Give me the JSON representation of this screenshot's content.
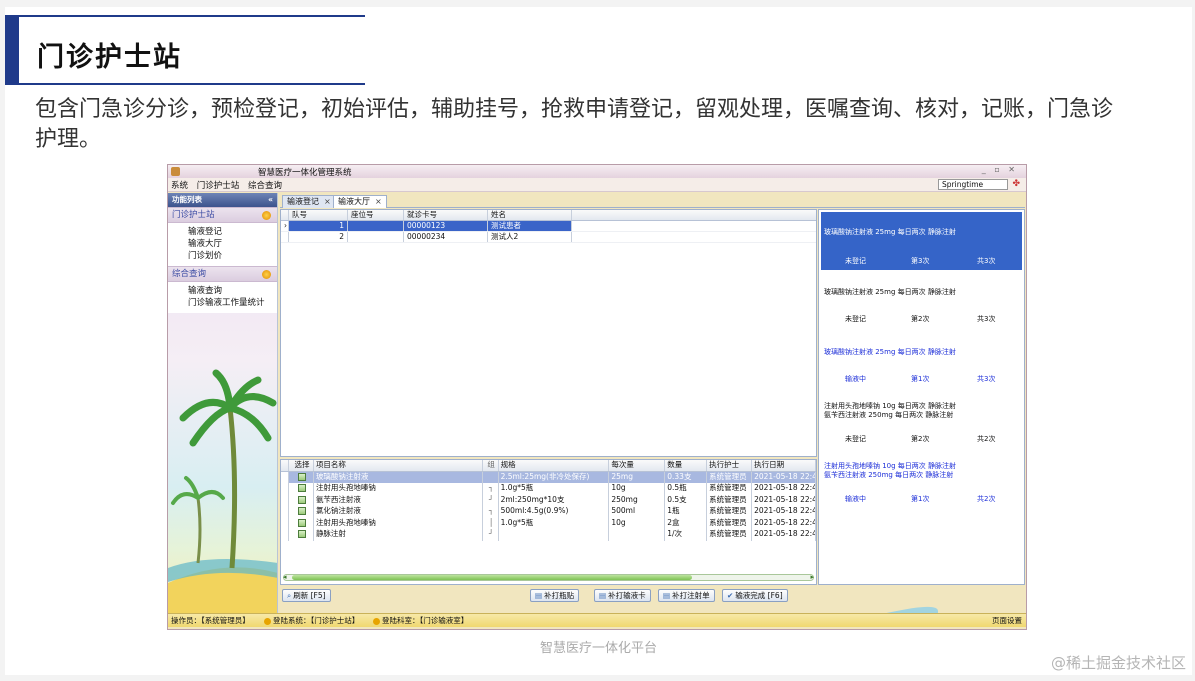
{
  "slide": {
    "title": "门诊护士站",
    "description": "包含门急诊分诊，预检登记，初始评估，辅助挂号，抢救申请登记，留观处理，医嘱查询、核对，记账，门急诊护理。",
    "footer": "智慧医疗一体化平台",
    "watermark": "@稀土掘金技术社区"
  },
  "window": {
    "title": "智慧医疗一体化管理系统",
    "controls": "_ ▫ ✕",
    "menu": [
      "系统",
      "门诊护士站",
      "综合查询"
    ],
    "user_select": "Springtime"
  },
  "nav": {
    "header": "功能列表",
    "pin": "«",
    "groups": [
      {
        "label": "门诊护士站",
        "items": [
          "输液登记",
          "输液大厅",
          "门诊划价"
        ]
      },
      {
        "label": "综合查询",
        "items": [
          "输液查询",
          "门诊输液工作量统计"
        ]
      }
    ]
  },
  "tabs": [
    {
      "label": "输液登记",
      "close": "×"
    },
    {
      "label": "输液大厅",
      "close": "×"
    }
  ],
  "queue_table": {
    "columns": [
      "队号",
      "座位号",
      "就诊卡号",
      "姓名"
    ],
    "rows": [
      {
        "queue": "1",
        "seat": "",
        "card": "00000123",
        "name": "测试患者"
      },
      {
        "queue": "2",
        "seat": "",
        "card": "00000234",
        "name": "测试人2"
      }
    ]
  },
  "items_table": {
    "columns": [
      "选择",
      "项目名称",
      "组",
      "规格",
      "每次量",
      "数量",
      "执行护士",
      "执行日期"
    ],
    "rows": [
      {
        "name": "玻璃酸钠注射液",
        "group": "",
        "spec": "2.5ml:25mg(非冷处保存)",
        "dose": "25mg",
        "qty": "0.33支",
        "nurse": "系统管理员",
        "date": "2021-05-18 22:43:"
      },
      {
        "name": "注射用头孢地嗪钠",
        "group": "┐",
        "spec": "1.0g*5瓶",
        "dose": "10g",
        "qty": "0.5瓶",
        "nurse": "系统管理员",
        "date": "2021-05-18 22:43:"
      },
      {
        "name": "氨苄西注射液",
        "group": "┘",
        "spec": "2ml:250mg*10支",
        "dose": "250mg",
        "qty": "0.5支",
        "nurse": "系统管理员",
        "date": "2021-05-18 22:43:"
      },
      {
        "name": "氯化钠注射液",
        "group": "┐",
        "spec": "500ml:4.5g(0.9%)",
        "dose": "500ml",
        "qty": "1瓶",
        "nurse": "系统管理员",
        "date": "2021-05-18 22:46:"
      },
      {
        "name": "注射用头孢地嗪钠",
        "group": "│",
        "spec": "1.0g*5瓶",
        "dose": "10g",
        "qty": "2盒",
        "nurse": "系统管理员",
        "date": "2021-05-18 22:46:"
      },
      {
        "name": "静脉注射",
        "group": "┘",
        "spec": "",
        "dose": "",
        "qty": "1/次",
        "nurse": "系统管理员",
        "date": "2021-05-18 22:46:"
      }
    ]
  },
  "infusion_list": [
    {
      "order": [
        "玻璃酸钠注射液 25mg 每日两次 静脉注射"
      ],
      "status": "未登记",
      "count": "第3次",
      "total": "共3次",
      "state": "selected"
    },
    {
      "order": [
        "玻璃酸钠注射液 25mg 每日两次 静脉注射"
      ],
      "status": "未登记",
      "count": "第2次",
      "total": "共3次",
      "state": "normal"
    },
    {
      "order": [
        "玻璃酸钠注射液 25mg 每日两次 静脉注射"
      ],
      "status": "输液中",
      "count": "第1次",
      "total": "共3次",
      "state": "blue"
    },
    {
      "order": [
        "注射用头孢地嗪钠 10g 每日两次 静脉注射",
        "氨苄西注射液 250mg 每日两次 静脉注射"
      ],
      "status": "未登记",
      "count": "第2次",
      "total": "共2次",
      "state": "normal"
    },
    {
      "order": [
        "注射用头孢地嗪钠 10g 每日两次 静脉注射",
        "氨苄西注射液 250mg 每日两次 静脉注射"
      ],
      "status": "输液中",
      "count": "第1次",
      "total": "共2次",
      "state": "blue"
    }
  ],
  "buttons": {
    "refresh": "刷新 [F5]",
    "print_label": "补打瓶贴",
    "print_card": "补打输液卡",
    "print_injection": "补打注射单",
    "complete": "输液完成 [F6]"
  },
  "status": {
    "operator": "操作员：【系统管理员】",
    "system": "登陆系统：【门诊护士站】",
    "dept": "登陆科室：【门诊输液室】",
    "page_setting": "页面设置"
  },
  "colors": {
    "title_accent": "#1f3a8a",
    "selected_card": "#3564c8",
    "in_progress_text": "#1e2fd8",
    "status_bar": "#f0d870"
  }
}
